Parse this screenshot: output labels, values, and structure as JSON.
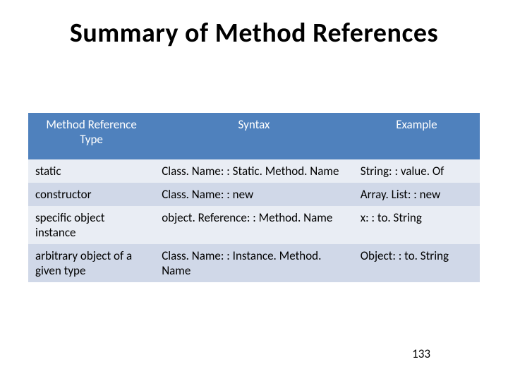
{
  "title": "Summary of Method References",
  "table": {
    "headers": {
      "type": "Method Reference Type",
      "syntax": "Syntax",
      "example": "Example"
    },
    "rows": [
      {
        "type": "static",
        "syntax": "Class. Name: : Static. Method. Name",
        "example": "String: : value. Of"
      },
      {
        "type": "constructor",
        "syntax": "Class. Name: : new",
        "example": "Array. List: : new"
      },
      {
        "type": "specific object instance",
        "syntax": "object. Reference: : Method. Name",
        "example": "x: : to. String"
      },
      {
        "type": "arbitrary object of a given type",
        "syntax": "Class. Name: : Instance. Method. Name",
        "example": "Object: : to. String"
      }
    ]
  },
  "page_number": "133"
}
